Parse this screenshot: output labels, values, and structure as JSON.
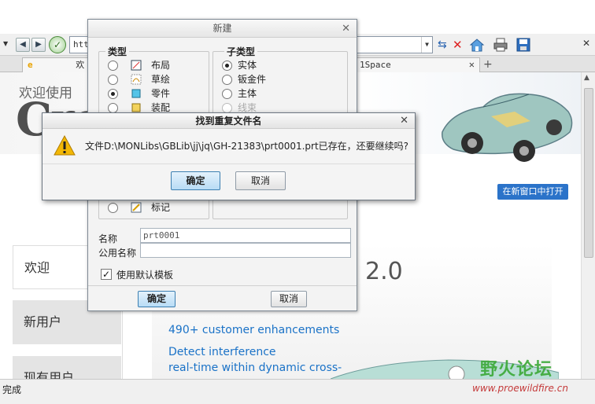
{
  "browser": {
    "url_text": "htt",
    "tabs": [
      {
        "label": "欢",
        "icon": "ie-icon"
      },
      {
        "label": "1Space"
      }
    ]
  },
  "page": {
    "welcome_heading": "欢迎使用",
    "logo_text": "Cre",
    "open_new_window": "在新窗口中打开",
    "nav": [
      "欢迎",
      "新用户",
      "现有用户"
    ],
    "version": "2.0",
    "promo": [
      "490+ customer enhancements",
      "Detect interference",
      "real-time within dynamic cross-"
    ],
    "watermark": "野火论坛",
    "watermark_url": "www.proewildfire.cn"
  },
  "status": {
    "text": "完成"
  },
  "new_dialog": {
    "title": "新建",
    "type_group_label": "类型",
    "subtype_group_label": "子类型",
    "types": [
      {
        "label": "布局",
        "selected": false
      },
      {
        "label": "草绘",
        "selected": false
      },
      {
        "label": "零件",
        "selected": true
      },
      {
        "label": "装配",
        "selected": false
      }
    ],
    "markup_type": {
      "label": "标记",
      "selected": false
    },
    "subtypes": [
      {
        "label": "实体",
        "selected": true
      },
      {
        "label": "钣金件",
        "selected": false
      },
      {
        "label": "主体",
        "selected": false
      },
      {
        "label": "线束",
        "selected": false,
        "disabled": true
      }
    ],
    "name_label": "名称",
    "name_value": "prt0001",
    "common_name_label": "公用名称",
    "common_name_value": "",
    "use_default_template": "使用默认模板",
    "use_default_checked": true,
    "ok": "确定",
    "cancel": "取消"
  },
  "dup_dialog": {
    "title": "找到重复文件名",
    "message": "文件D:\\MONLibs\\GBLib\\jj\\jq\\GH-21383\\prt0001.prt已存在，还要继续吗?",
    "ok": "确定",
    "cancel": "取消"
  },
  "colors": {
    "accent": "#2b73c9",
    "promo": "#1a72c7",
    "warning": "#f2b705"
  }
}
